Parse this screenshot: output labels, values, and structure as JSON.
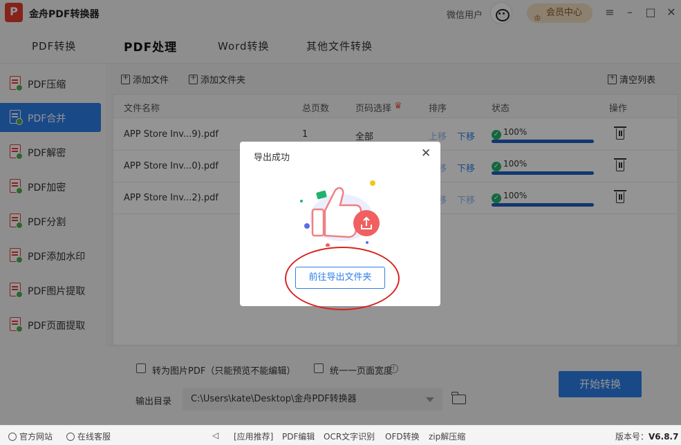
{
  "titlebar": {
    "app_title": "金舟PDF转换器",
    "user_name": "微信用户",
    "vip_label": "会员中心",
    "logo_text": "P"
  },
  "top_tabs": [
    {
      "label": "PDF转换",
      "active": false
    },
    {
      "label": "PDF处理",
      "active": true
    },
    {
      "label": "Word转换",
      "active": false
    },
    {
      "label": "其他文件转换",
      "active": false
    }
  ],
  "sidebar": {
    "items": [
      {
        "label": "PDF压缩",
        "active": false
      },
      {
        "label": "PDF合并",
        "active": true
      },
      {
        "label": "PDF解密",
        "active": false
      },
      {
        "label": "PDF加密",
        "active": false
      },
      {
        "label": "PDF分割",
        "active": false
      },
      {
        "label": "PDF添加水印",
        "active": false
      },
      {
        "label": "PDF图片提取",
        "active": false
      },
      {
        "label": "PDF页面提取",
        "active": false
      }
    ]
  },
  "toolbar": {
    "add_file": "添加文件",
    "add_folder": "添加文件夹",
    "clear_list": "清空列表"
  },
  "table": {
    "headers": {
      "name": "文件名称",
      "pages": "总页数",
      "page_select": "页码选择",
      "order": "排序",
      "status": "状态",
      "action": "操作"
    },
    "rows": [
      {
        "name": "APP Store Inv...9).pdf",
        "pages": "1",
        "page_select": "全部",
        "up": "上移",
        "down": "下移",
        "progress": 100,
        "progress_label": "100%"
      },
      {
        "name": "APP Store Inv...0).pdf",
        "pages": "",
        "page_select": "",
        "up": "上移",
        "down": "下移",
        "progress": 100,
        "progress_label": "100%"
      },
      {
        "name": "APP Store Inv...2).pdf",
        "pages": "",
        "page_select": "",
        "up": "上移",
        "down": "下移",
        "progress": 100,
        "progress_label": "100%"
      }
    ]
  },
  "settings": {
    "to_image_pdf": "转为图片PDF（只能预览不能编辑）",
    "unify_width": "统一一页面宽度",
    "output_dir_label": "输出目录",
    "output_path": "C:\\Users\\kate\\Desktop\\金舟PDF转换器",
    "start_button": "开始转换"
  },
  "footer": {
    "website": "官方网站",
    "support": "在线客服",
    "promo": "[应用推荐]",
    "links": [
      "PDF编辑",
      "OCR文字识别",
      "OFD转换",
      "zip解压缩"
    ],
    "version_label": "版本号：",
    "version": "V6.8.7"
  },
  "dialog": {
    "title": "导出成功",
    "button": "前往导出文件夹"
  },
  "colors": {
    "accent": "#2d7ee8",
    "success": "#21b36b",
    "brand_red": "#e63b2e",
    "annotation_red": "#d8231e"
  }
}
